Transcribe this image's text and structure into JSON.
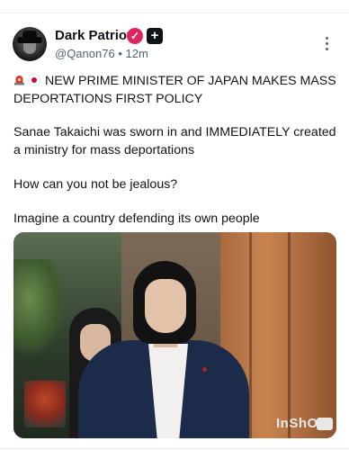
{
  "author": {
    "display_name": "Dark Patriot",
    "handle": "@Qanon76",
    "separator": "•",
    "time_ago": "12m"
  },
  "badges": {
    "verified_color": "#e0245e",
    "verified_glyph": "✓",
    "plus_glyph": "+"
  },
  "post": {
    "headline_flags": [
      "siren-icon",
      "japan-flag-icon"
    ],
    "headline": "NEW PRIME MINISTER OF JAPAN MAKES MASS DEPORTATIONS FIRST POLICY",
    "paragraph_1": "Sanae Takaichi was sworn in and IMMEDIATELY created a ministry for mass deportations",
    "paragraph_2": "How can you not be jealous?",
    "paragraph_3": "Imagine a country defending its own people"
  },
  "media": {
    "watermark": "InShO"
  },
  "colors": {
    "text_primary": "#0f1419",
    "text_secondary": "#536471",
    "divider": "#eceff1"
  }
}
